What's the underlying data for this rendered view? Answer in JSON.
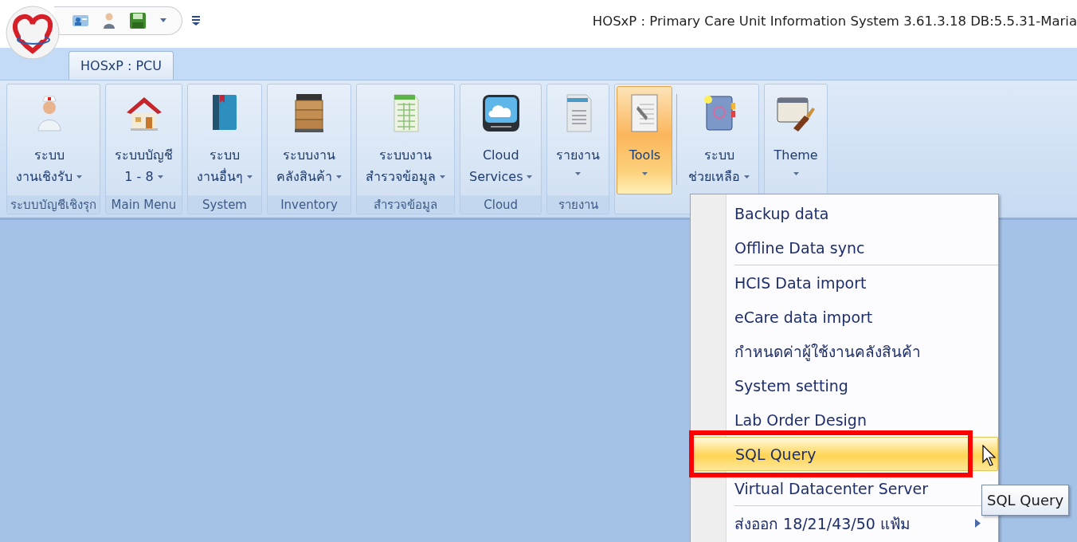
{
  "window": {
    "title": "HOSxP : Primary Care Unit Information System 3.61.3.18 DB:5.5.31-Maria"
  },
  "ribbon_tabs": [
    {
      "label": "HOSxP : PCU",
      "selected": true
    }
  ],
  "ribbon_groups": [
    {
      "caption": "ระบบบัญชีเชิงรุก",
      "buttons": [
        {
          "lines": [
            "ระบบ",
            "งานเชิงรับ"
          ],
          "dropdown": true,
          "selected": false
        }
      ]
    },
    {
      "caption": "Main Menu",
      "buttons": [
        {
          "lines": [
            "ระบบบัญชี",
            "1 - 8"
          ],
          "dropdown": true,
          "selected": false
        }
      ]
    },
    {
      "caption": "System",
      "buttons": [
        {
          "lines": [
            "ระบบ",
            "งานอื่นๆ"
          ],
          "dropdown": true,
          "selected": false
        }
      ]
    },
    {
      "caption": "Inventory",
      "buttons": [
        {
          "lines": [
            "ระบบงาน",
            "คลังสินค้า"
          ],
          "dropdown": true,
          "selected": false
        }
      ]
    },
    {
      "caption": "สำรวจข้อมูล",
      "buttons": [
        {
          "lines": [
            "ระบบงาน",
            "สำรวจข้อมูล"
          ],
          "dropdown": true,
          "selected": false
        }
      ]
    },
    {
      "caption": "Cloud",
      "buttons": [
        {
          "lines": [
            "Cloud",
            "Services"
          ],
          "dropdown": true,
          "selected": false
        }
      ]
    },
    {
      "caption": "รายงาน",
      "buttons": [
        {
          "lines": [
            "รายงาน"
          ],
          "dropdown": true,
          "selected": false
        }
      ]
    },
    {
      "buttons": [
        {
          "lines": [
            "Tools"
          ],
          "dropdown": true,
          "selected": true
        },
        {
          "lines": [
            "ระบบ",
            "ช่วยเหลือ"
          ],
          "dropdown": true,
          "selected": false
        }
      ]
    },
    {
      "buttons": [
        {
          "lines": [
            "Theme"
          ],
          "dropdown": true,
          "selected": false
        }
      ]
    }
  ],
  "menu": {
    "sections": [
      [
        {
          "label": "Backup data",
          "selected": false,
          "submenu": false,
          "highlighted": false
        },
        {
          "label": "Offline Data sync",
          "selected": false,
          "submenu": false,
          "highlighted": false
        }
      ],
      [
        {
          "label": "HCIS Data import",
          "selected": false,
          "submenu": false,
          "highlighted": false
        },
        {
          "label": "eCare data import",
          "selected": false,
          "submenu": false,
          "highlighted": false
        },
        {
          "label": "กำหนดค่าผู้ใช้งานคลังสินค้า",
          "selected": false,
          "submenu": false,
          "highlighted": false
        },
        {
          "label": "System setting",
          "selected": false,
          "submenu": false,
          "highlighted": false
        },
        {
          "label": "Lab Order Design",
          "selected": false,
          "submenu": false,
          "highlighted": false
        },
        {
          "label": "SQL Query",
          "selected": true,
          "submenu": false,
          "highlighted": true
        },
        {
          "label": "Virtual Datacenter Server",
          "selected": false,
          "submenu": false,
          "highlighted": false
        }
      ],
      [
        {
          "label": "ส่งออก 18/21/43/50 แฟ้ม",
          "selected": false,
          "submenu": true,
          "highlighted": false
        }
      ]
    ]
  },
  "tooltip": {
    "text": "SQL Query"
  }
}
